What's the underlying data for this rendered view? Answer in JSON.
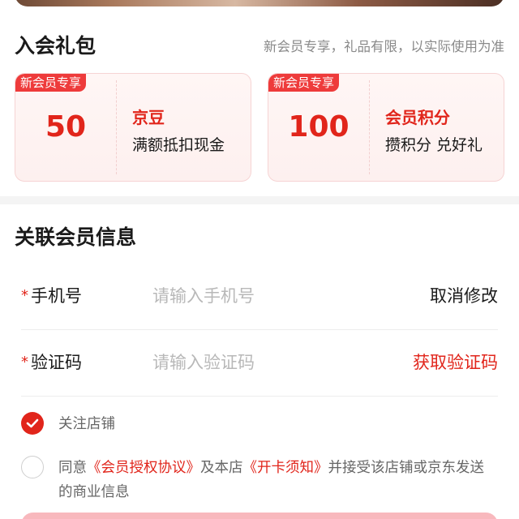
{
  "gift_section": {
    "title": "入会礼包",
    "note": "新会员专享，礼品有限，以实际使用为准",
    "cards": [
      {
        "tag": "新会员专享",
        "value": "50",
        "name": "京豆",
        "desc": "满额抵扣现金"
      },
      {
        "tag": "新会员专享",
        "value": "100",
        "name": "会员积分",
        "desc": "攒积分 兑好礼"
      }
    ]
  },
  "member_info": {
    "title": "关联会员信息",
    "phone": {
      "required_mark": "*",
      "label": "手机号",
      "placeholder": "请输入手机号",
      "value": "",
      "action": "取消修改"
    },
    "code": {
      "required_mark": "*",
      "label": "验证码",
      "placeholder": "请输入验证码",
      "value": "",
      "action": "获取验证码"
    }
  },
  "follow_store": {
    "checked": true,
    "label": "关注店铺"
  },
  "agreement": {
    "checked": false,
    "prefix": "同意",
    "link1": "《会员授权协议》",
    "middle": "及本店",
    "link2": "《开卡须知》",
    "suffix": "并接受该店铺或京东发送的商业信息"
  },
  "colors": {
    "accent": "#e1251b",
    "tag_bg": "#ee3b3b",
    "placeholder": "#b8b8b8",
    "muted_text": "#666666",
    "card_bg": "#fff6f5"
  }
}
